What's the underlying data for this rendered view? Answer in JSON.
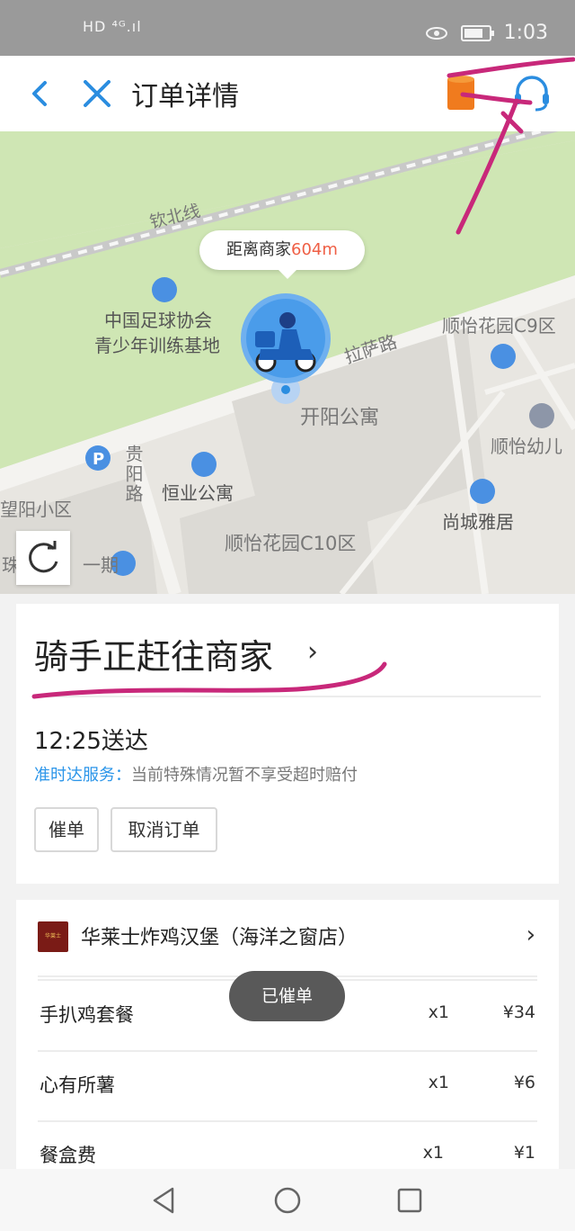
{
  "status_bar": {
    "network": "HD ⁴ᴳ.ıl",
    "time": "1:03"
  },
  "header": {
    "title": "订单详情",
    "back_icon": "back-arrow-icon",
    "close_icon": "close-icon",
    "box_icon": "order-box-icon",
    "service_icon": "customer-service-icon"
  },
  "map": {
    "distance_prefix": "距离商家",
    "distance_value": "604m",
    "labels": {
      "rail": "钦北线",
      "football": "中国足球协会",
      "football2": "青少年训练基地",
      "lasa": "拉萨路",
      "c9": "顺怡花园C9区",
      "kaiyang": "开阳公寓",
      "guiyang": "贵阳路",
      "shunyi_kid": "顺怡幼儿",
      "hengye": "恒业公寓",
      "wangyang": "望阳小区",
      "shangcheng": "尚城雅居",
      "c10": "顺怡花园C10区",
      "phase": "一期",
      "zhu": "珠"
    }
  },
  "order_status": {
    "title": "骑手正赶往商家",
    "eta": "12:25送达",
    "ontime_label": "准时达服务：",
    "ontime_text": "当前特殊情况暂不享受超时赔付",
    "urge_button": "催单",
    "cancel_button": "取消订单"
  },
  "shop": {
    "name": "华莱士炸鸡汉堡（海洋之窗店）",
    "logo_text": "华莱士 WALLACE",
    "items": [
      {
        "name": "手扒鸡套餐",
        "qty": "x1",
        "price": "¥34"
      },
      {
        "name": "心有所薯",
        "qty": "x1",
        "price": "¥6"
      },
      {
        "name": "餐盒费",
        "qty": "x1",
        "price": "¥1"
      }
    ]
  },
  "toast": "已催单",
  "colors": {
    "accent_blue": "#2b95e9",
    "distance_red": "#ef5f45",
    "annotation_pink": "#c8287a",
    "map_green": "#cfe6b4"
  }
}
